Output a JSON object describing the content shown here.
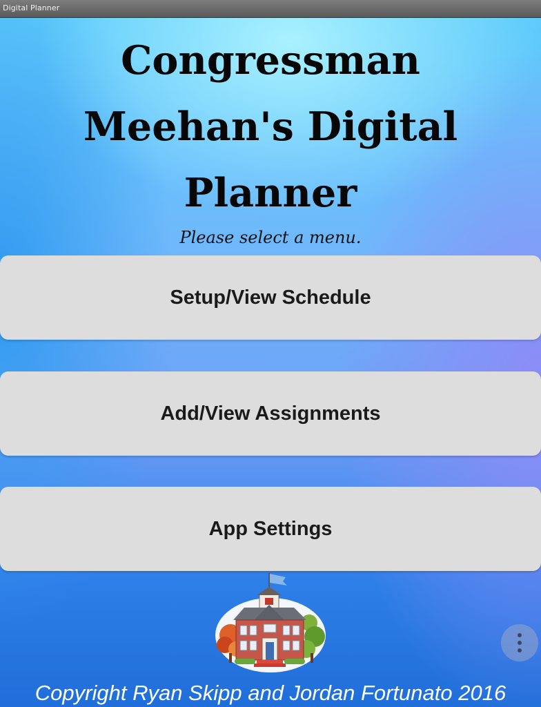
{
  "window": {
    "title": "Digital Planner"
  },
  "header": {
    "title_line1": "Congressman",
    "title_line2": "Meehan's Digital",
    "title_line3": "Planner",
    "subtitle": "Please select a menu."
  },
  "menu": {
    "items": [
      {
        "label": "Setup/View Schedule"
      },
      {
        "label": "Add/View Assignments"
      },
      {
        "label": "App Settings"
      }
    ]
  },
  "footer": {
    "copyright": "Copyright Ryan Skipp and Jordan Fortunato 2016"
  },
  "icons": {
    "logo": "schoolhouse-icon",
    "overflow": "more-vert-icon"
  },
  "colors": {
    "button_bg": "#dddddd",
    "title_text": "#070707",
    "footer_text": "#ffffff"
  }
}
